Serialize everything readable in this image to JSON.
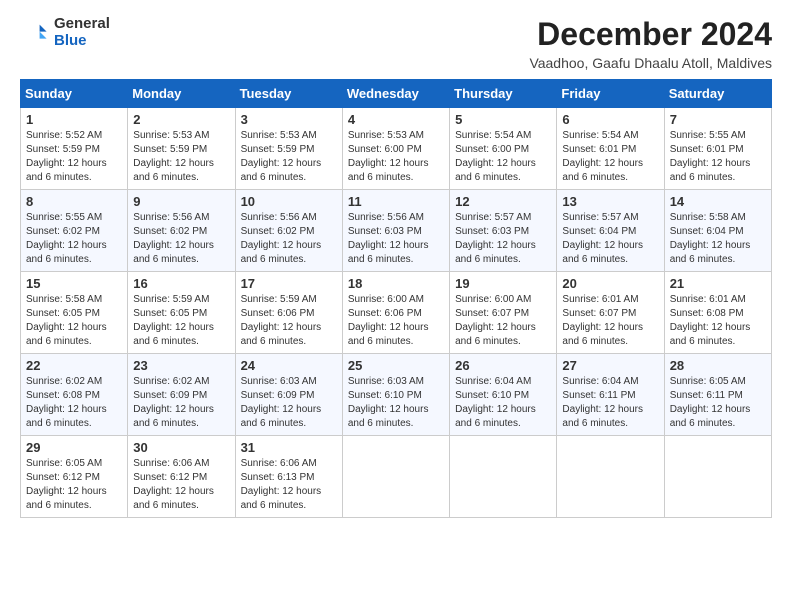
{
  "header": {
    "logo": {
      "general": "General",
      "blue": "Blue"
    },
    "month_title": "December 2024",
    "location": "Vaadhoo, Gaafu Dhaalu Atoll, Maldives"
  },
  "weekdays": [
    "Sunday",
    "Monday",
    "Tuesday",
    "Wednesday",
    "Thursday",
    "Friday",
    "Saturday"
  ],
  "weeks": [
    [
      {
        "day": "1",
        "info": "Sunrise: 5:52 AM\nSunset: 5:59 PM\nDaylight: 12 hours\nand 6 minutes."
      },
      {
        "day": "2",
        "info": "Sunrise: 5:53 AM\nSunset: 5:59 PM\nDaylight: 12 hours\nand 6 minutes."
      },
      {
        "day": "3",
        "info": "Sunrise: 5:53 AM\nSunset: 5:59 PM\nDaylight: 12 hours\nand 6 minutes."
      },
      {
        "day": "4",
        "info": "Sunrise: 5:53 AM\nSunset: 6:00 PM\nDaylight: 12 hours\nand 6 minutes."
      },
      {
        "day": "5",
        "info": "Sunrise: 5:54 AM\nSunset: 6:00 PM\nDaylight: 12 hours\nand 6 minutes."
      },
      {
        "day": "6",
        "info": "Sunrise: 5:54 AM\nSunset: 6:01 PM\nDaylight: 12 hours\nand 6 minutes."
      },
      {
        "day": "7",
        "info": "Sunrise: 5:55 AM\nSunset: 6:01 PM\nDaylight: 12 hours\nand 6 minutes."
      }
    ],
    [
      {
        "day": "8",
        "info": "Sunrise: 5:55 AM\nSunset: 6:02 PM\nDaylight: 12 hours\nand 6 minutes."
      },
      {
        "day": "9",
        "info": "Sunrise: 5:56 AM\nSunset: 6:02 PM\nDaylight: 12 hours\nand 6 minutes."
      },
      {
        "day": "10",
        "info": "Sunrise: 5:56 AM\nSunset: 6:02 PM\nDaylight: 12 hours\nand 6 minutes."
      },
      {
        "day": "11",
        "info": "Sunrise: 5:56 AM\nSunset: 6:03 PM\nDaylight: 12 hours\nand 6 minutes."
      },
      {
        "day": "12",
        "info": "Sunrise: 5:57 AM\nSunset: 6:03 PM\nDaylight: 12 hours\nand 6 minutes."
      },
      {
        "day": "13",
        "info": "Sunrise: 5:57 AM\nSunset: 6:04 PM\nDaylight: 12 hours\nand 6 minutes."
      },
      {
        "day": "14",
        "info": "Sunrise: 5:58 AM\nSunset: 6:04 PM\nDaylight: 12 hours\nand 6 minutes."
      }
    ],
    [
      {
        "day": "15",
        "info": "Sunrise: 5:58 AM\nSunset: 6:05 PM\nDaylight: 12 hours\nand 6 minutes."
      },
      {
        "day": "16",
        "info": "Sunrise: 5:59 AM\nSunset: 6:05 PM\nDaylight: 12 hours\nand 6 minutes."
      },
      {
        "day": "17",
        "info": "Sunrise: 5:59 AM\nSunset: 6:06 PM\nDaylight: 12 hours\nand 6 minutes."
      },
      {
        "day": "18",
        "info": "Sunrise: 6:00 AM\nSunset: 6:06 PM\nDaylight: 12 hours\nand 6 minutes."
      },
      {
        "day": "19",
        "info": "Sunrise: 6:00 AM\nSunset: 6:07 PM\nDaylight: 12 hours\nand 6 minutes."
      },
      {
        "day": "20",
        "info": "Sunrise: 6:01 AM\nSunset: 6:07 PM\nDaylight: 12 hours\nand 6 minutes."
      },
      {
        "day": "21",
        "info": "Sunrise: 6:01 AM\nSunset: 6:08 PM\nDaylight: 12 hours\nand 6 minutes."
      }
    ],
    [
      {
        "day": "22",
        "info": "Sunrise: 6:02 AM\nSunset: 6:08 PM\nDaylight: 12 hours\nand 6 minutes."
      },
      {
        "day": "23",
        "info": "Sunrise: 6:02 AM\nSunset: 6:09 PM\nDaylight: 12 hours\nand 6 minutes."
      },
      {
        "day": "24",
        "info": "Sunrise: 6:03 AM\nSunset: 6:09 PM\nDaylight: 12 hours\nand 6 minutes."
      },
      {
        "day": "25",
        "info": "Sunrise: 6:03 AM\nSunset: 6:10 PM\nDaylight: 12 hours\nand 6 minutes."
      },
      {
        "day": "26",
        "info": "Sunrise: 6:04 AM\nSunset: 6:10 PM\nDaylight: 12 hours\nand 6 minutes."
      },
      {
        "day": "27",
        "info": "Sunrise: 6:04 AM\nSunset: 6:11 PM\nDaylight: 12 hours\nand 6 minutes."
      },
      {
        "day": "28",
        "info": "Sunrise: 6:05 AM\nSunset: 6:11 PM\nDaylight: 12 hours\nand 6 minutes."
      }
    ],
    [
      {
        "day": "29",
        "info": "Sunrise: 6:05 AM\nSunset: 6:12 PM\nDaylight: 12 hours\nand 6 minutes."
      },
      {
        "day": "30",
        "info": "Sunrise: 6:06 AM\nSunset: 6:12 PM\nDaylight: 12 hours\nand 6 minutes."
      },
      {
        "day": "31",
        "info": "Sunrise: 6:06 AM\nSunset: 6:13 PM\nDaylight: 12 hours\nand 6 minutes."
      },
      {
        "day": "",
        "info": ""
      },
      {
        "day": "",
        "info": ""
      },
      {
        "day": "",
        "info": ""
      },
      {
        "day": "",
        "info": ""
      }
    ]
  ]
}
